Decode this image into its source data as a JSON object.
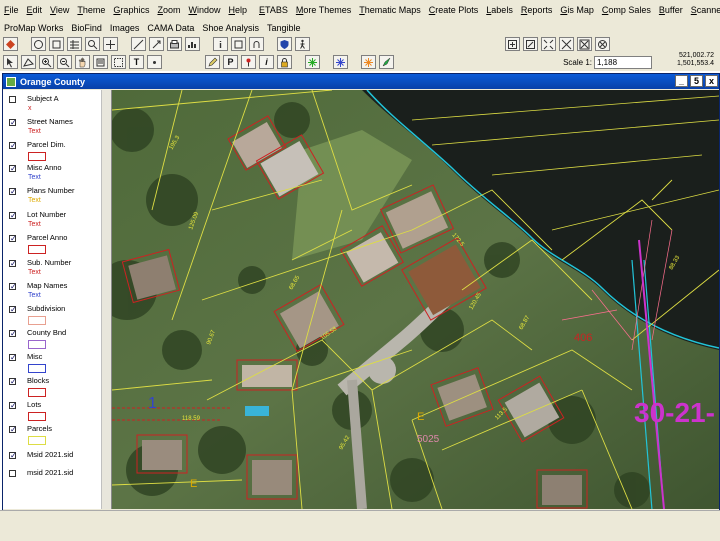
{
  "menu": {
    "row1": [
      "File",
      "Edit",
      "View",
      "Theme",
      "Graphics",
      "Zoom",
      "Window",
      "Help",
      "ETABS",
      "More Themes",
      "Thematic Maps",
      "Create Plots",
      "Labels",
      "Reports",
      "Gis Map",
      "Comp Sales",
      "Buffer",
      "Scanned Plats"
    ],
    "row2": [
      "ProMap Works",
      "BioFind",
      "Images",
      "CAMA Data",
      "Shoe Analysis",
      "Tangible"
    ]
  },
  "toolbar": {
    "scale_label": "Scale 1:",
    "scale_value": "1,188",
    "coords_x": "521,002.72",
    "coords_y": "1,501,553.4"
  },
  "window": {
    "title": "Orange County",
    "min_label": "_",
    "max_label": "5",
    "close_label": "x"
  },
  "legend": {
    "items": [
      {
        "name": "Subject A",
        "checked": false,
        "symbol": "x",
        "symbol_color": "#cc2222"
      },
      {
        "name": "Street Names",
        "checked": true,
        "symbol": "Text",
        "symbol_color": "#cc2222"
      },
      {
        "name": "Parcel Dim.",
        "checked": true,
        "symbol": "",
        "symbol_color": "#cc2222"
      },
      {
        "name": "Misc Anno",
        "checked": true,
        "symbol": "Text",
        "symbol_color": "#3344cc"
      },
      {
        "name": "Plans Number",
        "checked": true,
        "symbol": "Text",
        "symbol_color": "#ddaa00"
      },
      {
        "name": "Lot Number",
        "checked": true,
        "symbol": "Text",
        "symbol_color": "#cc2222"
      },
      {
        "name": "Parcel Anno",
        "checked": true,
        "symbol": "",
        "symbol_color": "#cc2222"
      },
      {
        "name": "Sub. Number",
        "checked": true,
        "symbol": "Text",
        "symbol_color": "#cc2222"
      },
      {
        "name": "Map Names",
        "checked": true,
        "symbol": "Text",
        "symbol_color": "#3344cc"
      },
      {
        "name": "Subdivision",
        "checked": true,
        "symbol": "",
        "symbol_color": "#e8a090"
      },
      {
        "name": "County Bnd",
        "checked": true,
        "symbol": "",
        "symbol_color": "#9966cc"
      },
      {
        "name": "Misc",
        "checked": true,
        "symbol": "",
        "symbol_color": "#3344cc"
      },
      {
        "name": "Blocks",
        "checked": true,
        "symbol": "",
        "symbol_color": "#cc2222"
      },
      {
        "name": "Lots",
        "checked": true,
        "symbol": "",
        "symbol_color": "#cc2222"
      },
      {
        "name": "Parcels",
        "checked": true,
        "symbol": "",
        "symbol_color": "#dddd44"
      },
      {
        "name": "Msid 2021.sid",
        "checked": true,
        "symbol": "",
        "symbol_color": ""
      },
      {
        "name": "msid 2021.sid",
        "checked": false,
        "symbol": "",
        "symbol_color": ""
      }
    ]
  },
  "map": {
    "labels": [
      {
        "text": "30-21-",
        "color": "#cc33cc"
      },
      {
        "text": "406",
        "color": "#cc2222"
      },
      {
        "text": "1",
        "color": "#3344cc"
      },
      {
        "text": "E",
        "color": "#ddaa00"
      },
      {
        "text": "E",
        "color": "#ddaa00"
      },
      {
        "text": "5025",
        "color": "#dd88aa"
      }
    ],
    "colors": {
      "parcel": "#dddd44",
      "lot": "#cc2222",
      "water": "#22c4d8",
      "county": "#cc33cc"
    }
  }
}
